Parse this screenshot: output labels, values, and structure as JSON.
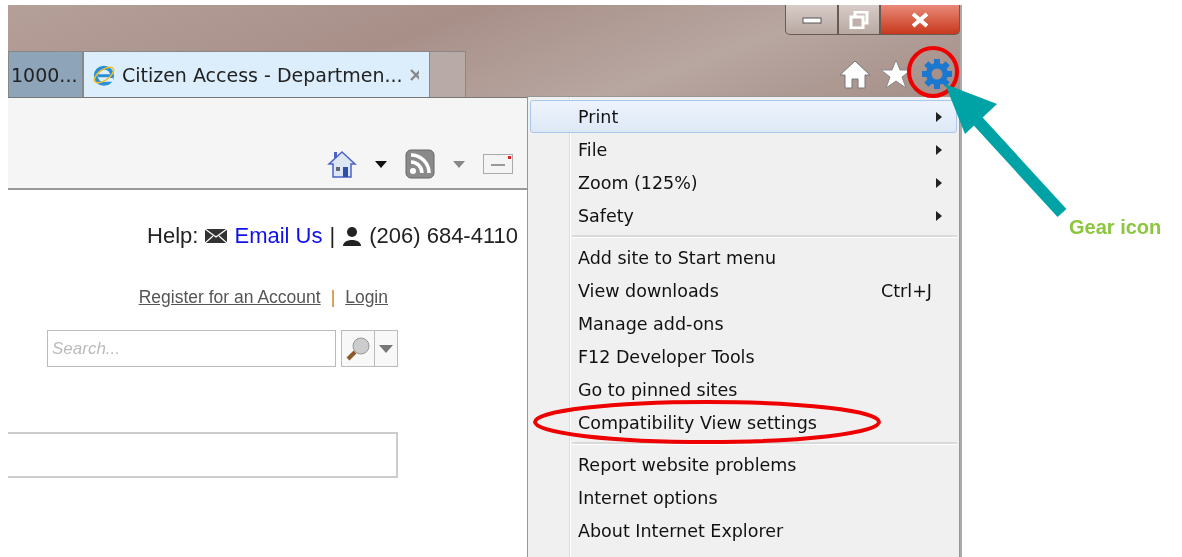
{
  "tabs": [
    {
      "title": "1000...",
      "selected": false,
      "favicon": false
    },
    {
      "title": "Citizen Access - Departmen...",
      "selected": true,
      "favicon": true
    }
  ],
  "page": {
    "help_label": "Help:",
    "email_link": "Email Us",
    "divider": "|",
    "phone": "(206) 684-4110",
    "register_link": "Register for an Account",
    "link_divider": "|",
    "login_link": "Login",
    "search": {
      "placeholder": "Search..."
    }
  },
  "menu": [
    {
      "kind": "submenu",
      "label": "Print",
      "selected": true
    },
    {
      "kind": "submenu",
      "label": "File",
      "selected": false
    },
    {
      "kind": "submenu",
      "label": "Zoom (125%)",
      "selected": false
    },
    {
      "kind": "submenu",
      "label": "Safety",
      "selected": false
    },
    {
      "kind": "separator"
    },
    {
      "kind": "item",
      "label": "Add site to Start menu",
      "selected": false
    },
    {
      "kind": "item",
      "label": "View downloads",
      "shortcut": "Ctrl+J",
      "selected": false
    },
    {
      "kind": "item",
      "label": "Manage add-ons",
      "selected": false
    },
    {
      "kind": "item",
      "label": "F12 Developer Tools",
      "selected": false
    },
    {
      "kind": "item",
      "label": "Go to pinned sites",
      "selected": false
    },
    {
      "kind": "item",
      "label": "Compatibility View settings",
      "selected": false,
      "circled": true
    },
    {
      "kind": "separator"
    },
    {
      "kind": "item",
      "label": "Report website problems",
      "selected": false
    },
    {
      "kind": "item",
      "label": "Internet options",
      "selected": false
    },
    {
      "kind": "item",
      "label": "About Internet Explorer",
      "selected": false
    }
  ],
  "annotation": {
    "label": "Gear icon"
  }
}
